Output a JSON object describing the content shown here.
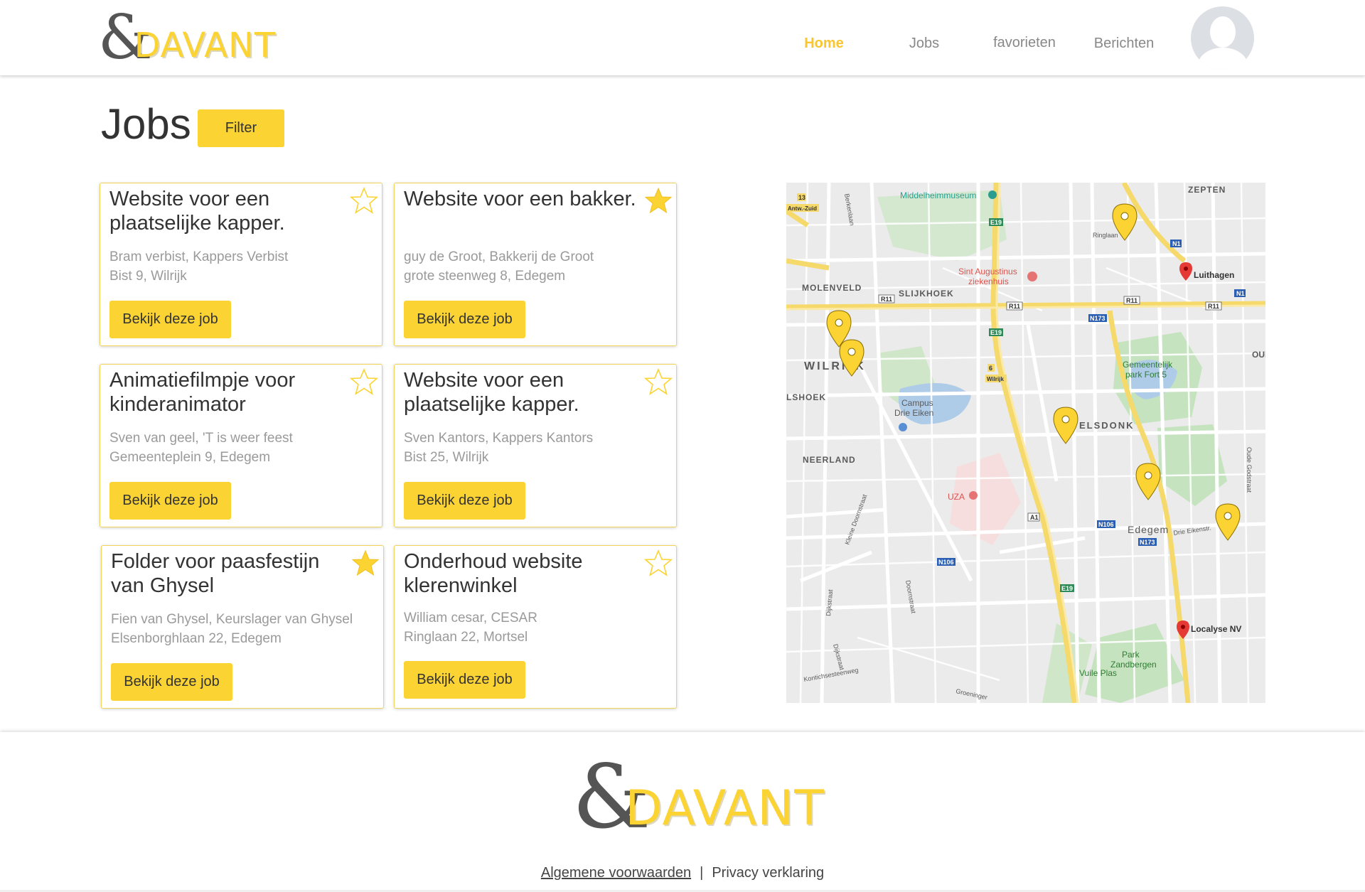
{
  "brand": {
    "amp": "&",
    "word": "DAVANT",
    "accent": "#fbd332"
  },
  "nav": {
    "items": [
      {
        "label": "Home",
        "active": true
      },
      {
        "label": "Jobs",
        "active": false
      },
      {
        "label": "favorieten",
        "active": false
      },
      {
        "label": "Berichten",
        "active": false
      }
    ],
    "avatar_icon": "user-avatar-icon"
  },
  "page": {
    "title": "Jobs",
    "filter_label": "Filter"
  },
  "jobs": [
    {
      "title": "Website voor een plaatselijke kapper.",
      "contact": "Bram verbist, Kappers Verbist",
      "address": "Bist 9, Wilrijk",
      "button": "Bekijk deze job",
      "favorite": false
    },
    {
      "title": "Website voor een bakker.",
      "contact": "guy de Groot, Bakkerij de Groot",
      "address": "grote steenweg 8, Edegem",
      "button": "Bekijk deze job",
      "favorite": true
    },
    {
      "title": "Animatiefilmpje voor kinderanimator",
      "contact": "Sven van geel, 'T is weer feest",
      "address": "Gemeenteplein 9, Edegem",
      "button": "Bekijk deze job",
      "favorite": false
    },
    {
      "title": "Website voor een plaatselijke kapper.",
      "contact": "Sven Kantors, Kappers Kantors",
      "address": "Bist 25, Wilrijk",
      "button": "Bekijk deze job",
      "favorite": false
    },
    {
      "title": "Folder voor paasfestijn van Ghysel",
      "contact": "Fien van Ghysel, Keurslager van Ghysel",
      "address": "Elsenborghlaan 22, Edegem",
      "button": "Bekijk deze job",
      "favorite": true
    },
    {
      "title": "Onderhoud website klerenwinkel",
      "contact": "William cesar, CESAR",
      "address": "Ringlaan 22, Mortsel",
      "button": "Bekijk deze job",
      "favorite": false
    }
  ],
  "map": {
    "labels": {
      "zepten": "ZEPTEN",
      "middelheim": "Middelheimmuseum",
      "antw_zuid": "Antw.-Zuid",
      "molenveld": "MOLENVELD",
      "slijkhoek": "SLIJKHOEK",
      "sint_aug_1": "Sint Augustinus",
      "sint_aug_2": "ziekenhuis",
      "luithagen": "Luithagen",
      "ringlaan": "Ringlaan",
      "wilrijk": "WILRIJK",
      "slshoek": "LSHOEK",
      "campus_1": "Campus",
      "campus_2": "Drie Eiken",
      "elsdonk": "ELSDONK",
      "fort_1": "Gemeentelijk",
      "fort_2": "park Fort 5",
      "oud": "OUD",
      "neerland": "NEERLAND",
      "uza": "UZA",
      "edegem": "Edegem",
      "drie_eiken": "Drie Eikenstr.",
      "oude_godstraat": "Oude Godstraat",
      "localyse": "Localyse NV",
      "park_z_1": "Park",
      "park_z_2": "Zandbergen",
      "vuile_plas": "Vuile Plas",
      "kleine_doornstraat": "Kleine Doornstraat",
      "doornstraat": "Doornstraat",
      "dijkstraat": "Dijkstraat",
      "kontich": "Kontichsesteenweg",
      "groening": "Groeninger",
      "berkenlaan": "Berkenlaan"
    },
    "shields": {
      "r11": "R11",
      "e19": "E19",
      "n1": "N1",
      "n173": "N173",
      "n106": "N106",
      "a1": "A1",
      "e13": "13",
      "wilrijk_exit": "Wilrijk",
      "exit6": "6"
    },
    "marker_color": "#fbd332",
    "poi_color": "#e53935"
  },
  "footer": {
    "terms": "Algemene voorwaarden",
    "separator": "|",
    "privacy": "Privacy verklaring"
  }
}
